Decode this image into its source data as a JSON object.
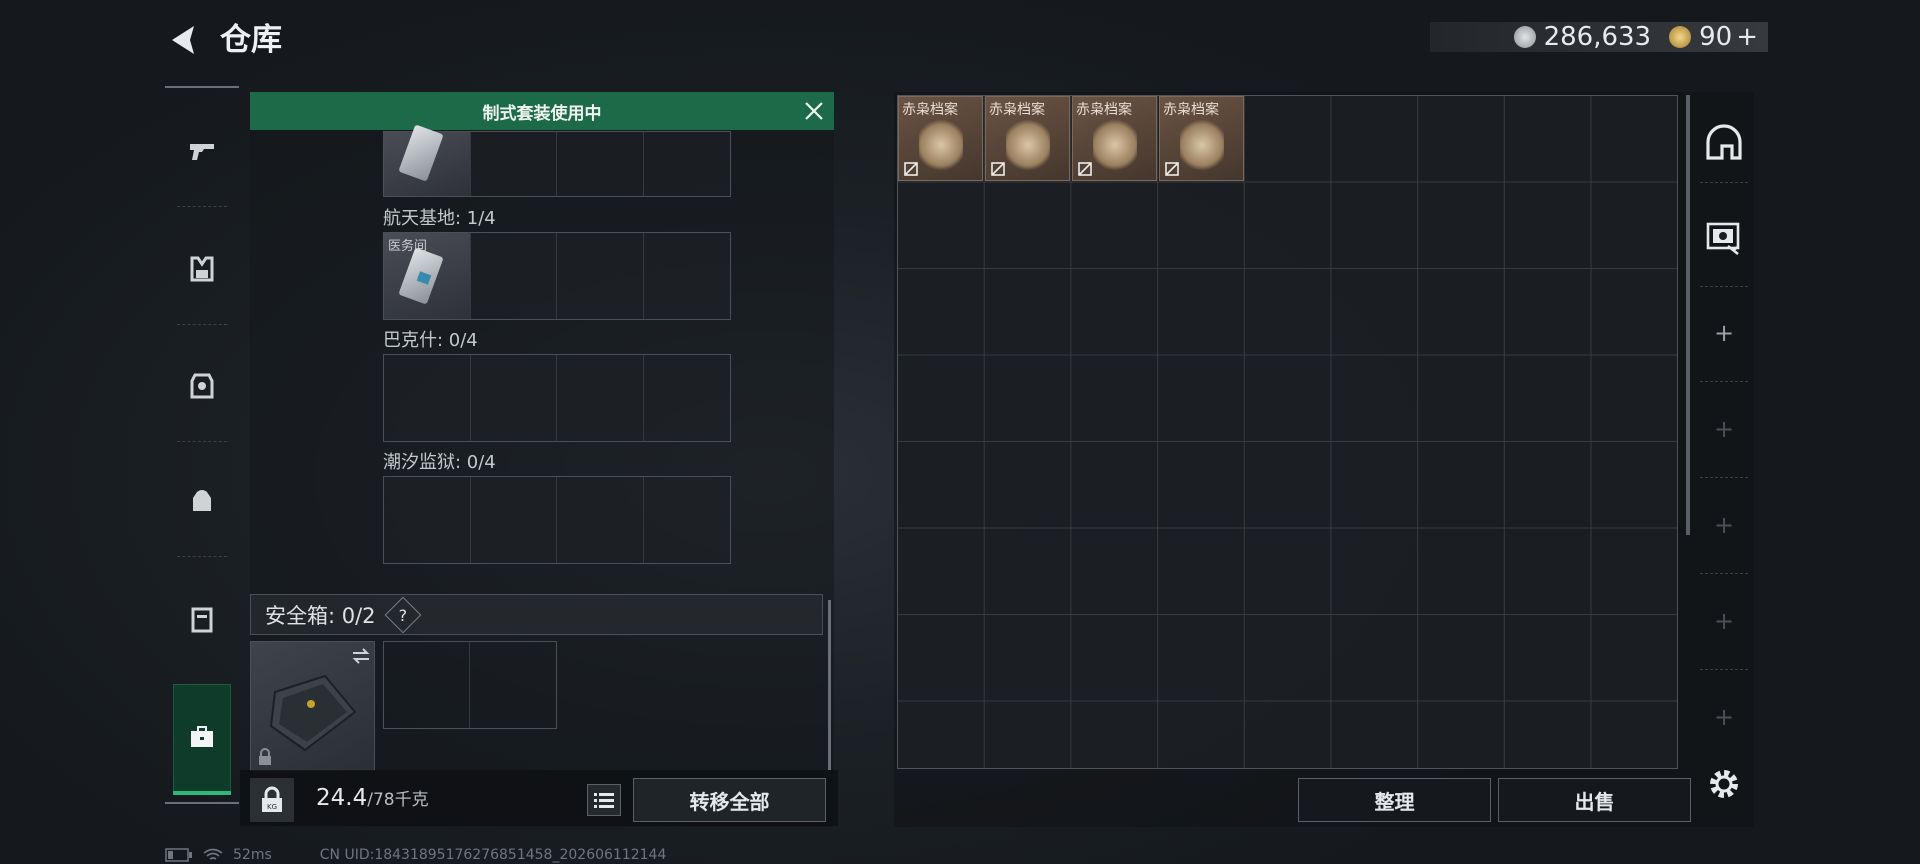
{
  "header": {
    "title": "仓库",
    "currency_primary": "286,633",
    "currency_secondary": "90"
  },
  "banner": {
    "text": "制式套装使用中"
  },
  "cases": {
    "card_label": "医务间",
    "groups": [
      {
        "label": "航天基地: 1/4"
      },
      {
        "label": "巴克什: 0/4"
      },
      {
        "label": "潮汐监狱: 0/4"
      }
    ]
  },
  "safe": {
    "label": "安全箱:  0/2",
    "help": "?"
  },
  "bottom": {
    "weight": "24.4",
    "weight_max": "/78千克",
    "transfer_all": "转移全部"
  },
  "stash": {
    "item_label": "赤枭档案",
    "items_count": 4,
    "sort_label": "整理",
    "sell_label": "出售"
  },
  "status": {
    "ping": "52ms",
    "uid": "CN UID:1843189517627685145​8_202606112144"
  },
  "colors": {
    "banner": "#1c6a47",
    "active_tab": "#0f3b2b",
    "accent_green": "#2eb87a"
  },
  "icons": {
    "rail": [
      "gun-icon",
      "vest-icon",
      "armor-icon",
      "backpack-icon",
      "container-icon",
      "briefcase-icon"
    ],
    "side": [
      "helmet-slot-icon",
      "case-key-icon",
      "settings-icon"
    ]
  }
}
